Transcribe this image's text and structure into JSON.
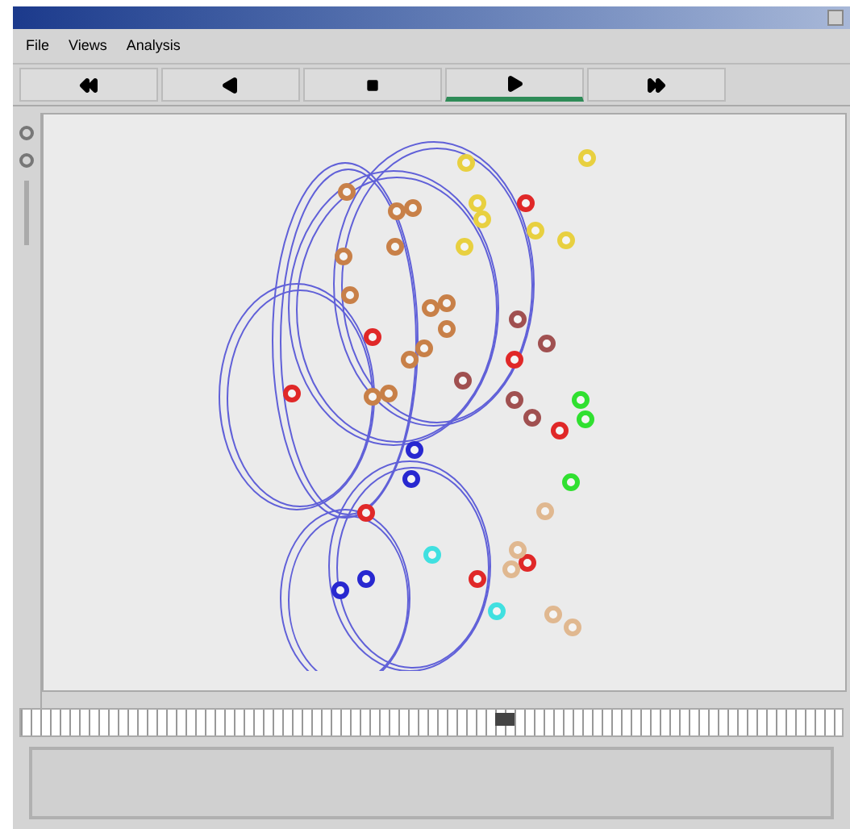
{
  "menus": [
    "File",
    "Views",
    "Analysis"
  ],
  "controls": [
    {
      "kind": "rewind",
      "selected": false
    },
    {
      "kind": "back",
      "selected": false
    },
    {
      "kind": "stop",
      "selected": false
    },
    {
      "kind": "play",
      "selected": true
    },
    {
      "kind": "forward",
      "selected": false
    }
  ],
  "nodes": [
    {
      "color": "#e8d040"
    },
    {
      "color": "#e8d040"
    },
    {
      "color": "#e8d040"
    },
    {
      "color": "#e8d040"
    },
    {
      "color": "#e8d040"
    },
    {
      "color": "#e8d040"
    },
    {
      "color": "#e8d040"
    },
    {
      "color": "#e02828"
    },
    {
      "color": "#e02828"
    },
    {
      "color": "#e02828"
    },
    {
      "color": "#e02828"
    },
    {
      "color": "#e02828"
    },
    {
      "color": "#e02828"
    },
    {
      "color": "#e02828"
    },
    {
      "color": "#e02828"
    },
    {
      "color": "#c88048"
    },
    {
      "color": "#c88048"
    },
    {
      "color": "#c88048"
    },
    {
      "color": "#c88048"
    },
    {
      "color": "#c88048"
    },
    {
      "color": "#c88048"
    },
    {
      "color": "#c88048"
    },
    {
      "color": "#c88048"
    },
    {
      "color": "#c88048"
    },
    {
      "color": "#c88048"
    },
    {
      "color": "#c88048"
    },
    {
      "color": "#c88048"
    },
    {
      "color": "#c88048"
    },
    {
      "color": "#a05050"
    },
    {
      "color": "#a05050"
    },
    {
      "color": "#a05050"
    },
    {
      "color": "#a05050"
    },
    {
      "color": "#a05050"
    },
    {
      "color": "#30e030"
    },
    {
      "color": "#30e030"
    },
    {
      "color": "#30e030"
    },
    {
      "color": "#2828d0"
    },
    {
      "color": "#2828d0"
    },
    {
      "color": "#2828d0"
    },
    {
      "color": "#2828d0"
    },
    {
      "color": "#40e0e0"
    },
    {
      "color": "#40e0e0"
    },
    {
      "color": "#e0b890"
    },
    {
      "color": "#e0b890"
    },
    {
      "color": "#e0b890"
    },
    {
      "color": "#e0b890"
    },
    {
      "color": "#e0b890"
    }
  ],
  "timeline": {
    "level": 0.59
  }
}
